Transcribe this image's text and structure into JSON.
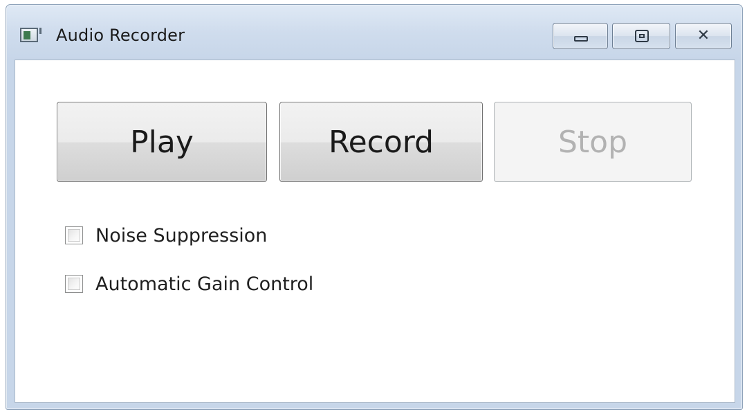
{
  "window": {
    "title": "Audio Recorder",
    "icon": "app-window-icon",
    "controls": {
      "minimize_icon": "minimize-icon",
      "maximize_icon": "maximize-icon",
      "close_icon": "close-icon",
      "close_glyph": "✕"
    }
  },
  "buttons": {
    "play_label": "Play",
    "record_label": "Record",
    "stop_label": "Stop",
    "stop_enabled": false
  },
  "options": [
    {
      "label": "Noise Suppression",
      "checked": false
    },
    {
      "label": "Automatic Gain Control",
      "checked": false
    }
  ],
  "colors": {
    "title_bar": "#cfdced",
    "disabled_text": "#b2b2b2"
  }
}
